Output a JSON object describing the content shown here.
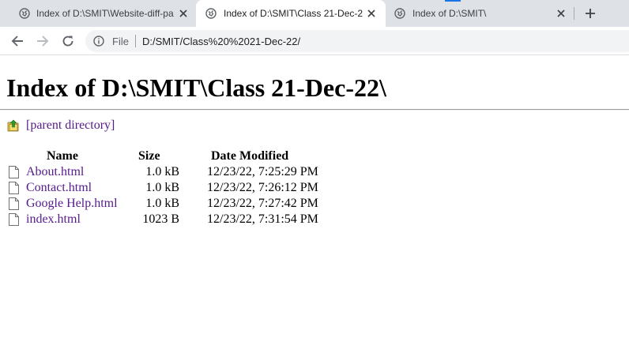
{
  "browser": {
    "tabs": [
      {
        "title": "Index of D:\\SMIT\\Website-diff-pa",
        "active": false
      },
      {
        "title": "Index of D:\\SMIT\\Class 21-Dec-2",
        "active": true
      },
      {
        "title": "Index of D:\\SMIT\\",
        "active": false
      }
    ],
    "new_tab_icon": "plus-icon",
    "omnibox": {
      "scheme_label": "File",
      "url": "D:/SMIT/Class%20%2021-Dec-22/"
    }
  },
  "page": {
    "title": "Index of D:\\SMIT\\Class 21-Dec-22\\",
    "parent_link": "[parent directory]",
    "columns": {
      "name": "Name",
      "size": "Size",
      "date": "Date Modified"
    },
    "files": [
      {
        "name": "About.html",
        "size": "1.0 kB",
        "date": "12/23/22, 7:25:29 PM"
      },
      {
        "name": "Contact.html",
        "size": "1.0 kB",
        "date": "12/23/22, 7:26:12 PM"
      },
      {
        "name": "Google Help.html",
        "size": "1.0 kB",
        "date": "12/23/22, 7:27:42 PM"
      },
      {
        "name": "index.html",
        "size": "1023 B",
        "date": "12/23/22, 7:31:54 PM"
      }
    ]
  },
  "colors": {
    "tabstrip_bg": "#dee1e6",
    "visited_link": "#551a8b",
    "omnibox_bg": "#f1f3f4",
    "accent": "#1a73e8"
  }
}
